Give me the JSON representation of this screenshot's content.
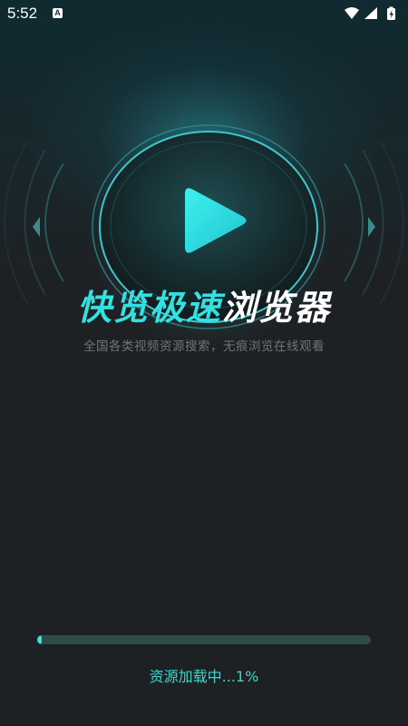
{
  "status_bar": {
    "time": "5:52",
    "notification_icon": "A",
    "icons": [
      "wifi-icon",
      "signal-icon",
      "battery-charging-icon"
    ]
  },
  "splash": {
    "logo_icon": "play-icon",
    "title_accent": "快览极速",
    "title_rest": "浏览器",
    "subtitle": "全国各类视频资源搜索，无痕浏览在线观看"
  },
  "loading": {
    "progress": 0.01,
    "label": "资源加载中...1%"
  },
  "colors": {
    "accent": "#34e0e0",
    "background": "#1e2124",
    "progress_track": "#2f4b4c",
    "progress_fill": "#3ee0d8"
  }
}
